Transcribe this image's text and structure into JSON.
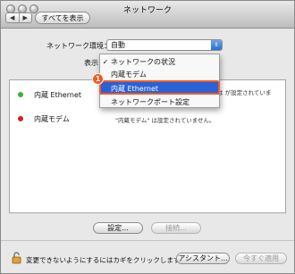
{
  "window": {
    "title": "ネットワーク"
  },
  "toolbar": {
    "back_label": "◀",
    "forward_label": "▶",
    "show_all_label": "すべてを表示"
  },
  "location": {
    "label": "ネットワーク環境：",
    "value": "自動"
  },
  "show": {
    "label": "表示："
  },
  "menu": {
    "items": [
      {
        "label": "ネットワークの状況",
        "checked": true
      },
      {
        "label": "内蔵モデム",
        "checked": false
      },
      {
        "label": "内蔵 Ethernet",
        "checked": false,
        "selected": true
      },
      {
        "label": "ネットワークポート設定",
        "checked": false
      }
    ],
    "check_mark": "✓"
  },
  "step_badge": "1",
  "list": {
    "rows": [
      {
        "name": "内蔵 Ethernet",
        "status": "は  が設定されていま",
        "status_color": "#3cb043"
      },
      {
        "name": "内蔵モデム",
        "status": "\"内蔵モデム\" は設定されていません。",
        "status_color": "#d81e1e"
      }
    ]
  },
  "buttons": {
    "configure": "設定...",
    "connect": "接続..."
  },
  "footer": {
    "lock_text": "変更できないようにするにはカギをクリックします。",
    "assistant": "アシスタント...",
    "apply": "今すぐ適用"
  },
  "colors": {
    "highlight": "#f15a24",
    "selection": "#2a62d6"
  }
}
